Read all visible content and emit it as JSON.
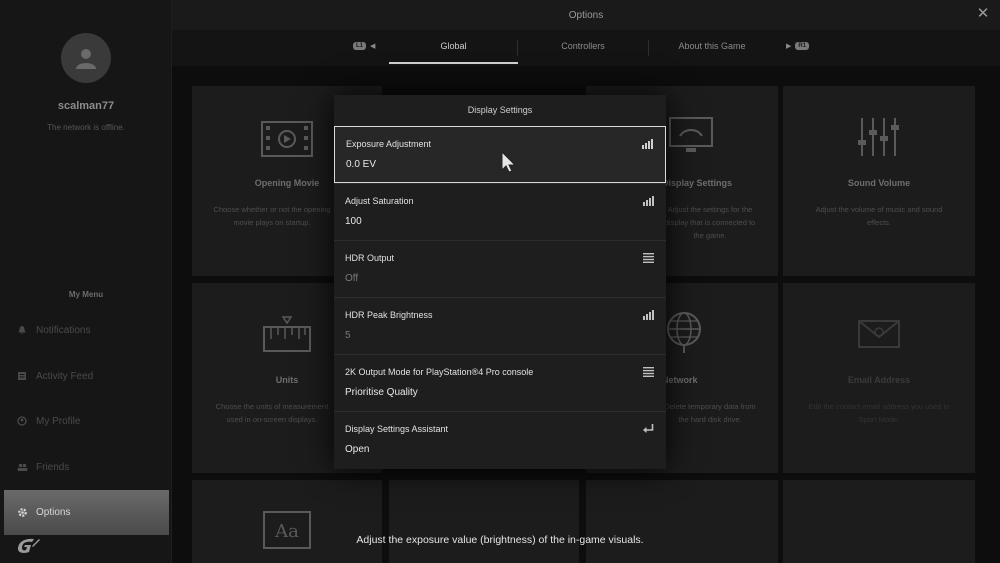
{
  "window": {
    "title": "Options",
    "close_glyph": "✕"
  },
  "profile": {
    "username": "scalman77",
    "network_status": "The network is offline."
  },
  "sidebar": {
    "menu_title": "My Menu",
    "items": [
      {
        "label": "Notifications",
        "icon": "bell-icon"
      },
      {
        "label": "Activity Feed",
        "icon": "feed-icon"
      },
      {
        "label": "My Profile",
        "icon": "profile-icon"
      },
      {
        "label": "Friends",
        "icon": "friends-icon"
      },
      {
        "label": "Options",
        "icon": "gear-icon",
        "active": true
      }
    ]
  },
  "tabs": {
    "prev_button": "L1",
    "next_button": "R1",
    "items": [
      {
        "label": "Global",
        "active": true
      },
      {
        "label": "Controllers"
      },
      {
        "label": "About this Game"
      }
    ]
  },
  "tiles": [
    {
      "title": "Opening Movie",
      "desc": "Choose whether or not the opening movie plays on startup.",
      "icon": "film-icon"
    },
    {
      "title": "Display Settings",
      "desc": "Adjust the settings for the display that is connected to the game.",
      "icon": "monitor-icon"
    },
    {
      "title": "Sound Volume",
      "desc": "Adjust the volume of music and sound effects.",
      "icon": "sliders-icon"
    },
    {
      "title": "Units",
      "desc": "Choose the units of measurement used in on-screen displays.",
      "icon": "ruler-icon"
    },
    {
      "title": "Network",
      "desc": "Delete temporary data from the hard disk drive.",
      "icon": "globe-icon"
    },
    {
      "title": "Email Address",
      "desc": "Edit the contact email address you used in Sport Mode.",
      "icon": "envelope-icon"
    },
    {
      "title": "Aa",
      "desc": "",
      "icon": "font-icon"
    }
  ],
  "modal": {
    "title": "Display Settings",
    "rows": [
      {
        "label": "Exposure Adjustment",
        "value": "0.0 EV",
        "icon": "slider-bars-icon",
        "selected": true
      },
      {
        "label": "Adjust Saturation",
        "value": "100",
        "icon": "slider-bars-icon"
      },
      {
        "label": "HDR Output",
        "value": "Off",
        "icon": "list-icon",
        "muted": true
      },
      {
        "label": "HDR Peak Brightness",
        "value": "5",
        "icon": "slider-bars-icon",
        "muted": true
      },
      {
        "label": "2K Output Mode for PlayStation®4 Pro console",
        "value": "Prioritise Quality",
        "icon": "list-icon"
      },
      {
        "label": "Display Settings Assistant",
        "value": "Open",
        "icon": "enter-icon"
      }
    ]
  },
  "footer": {
    "help_text": "Adjust the exposure value (brightness) of the in-game visuals."
  }
}
